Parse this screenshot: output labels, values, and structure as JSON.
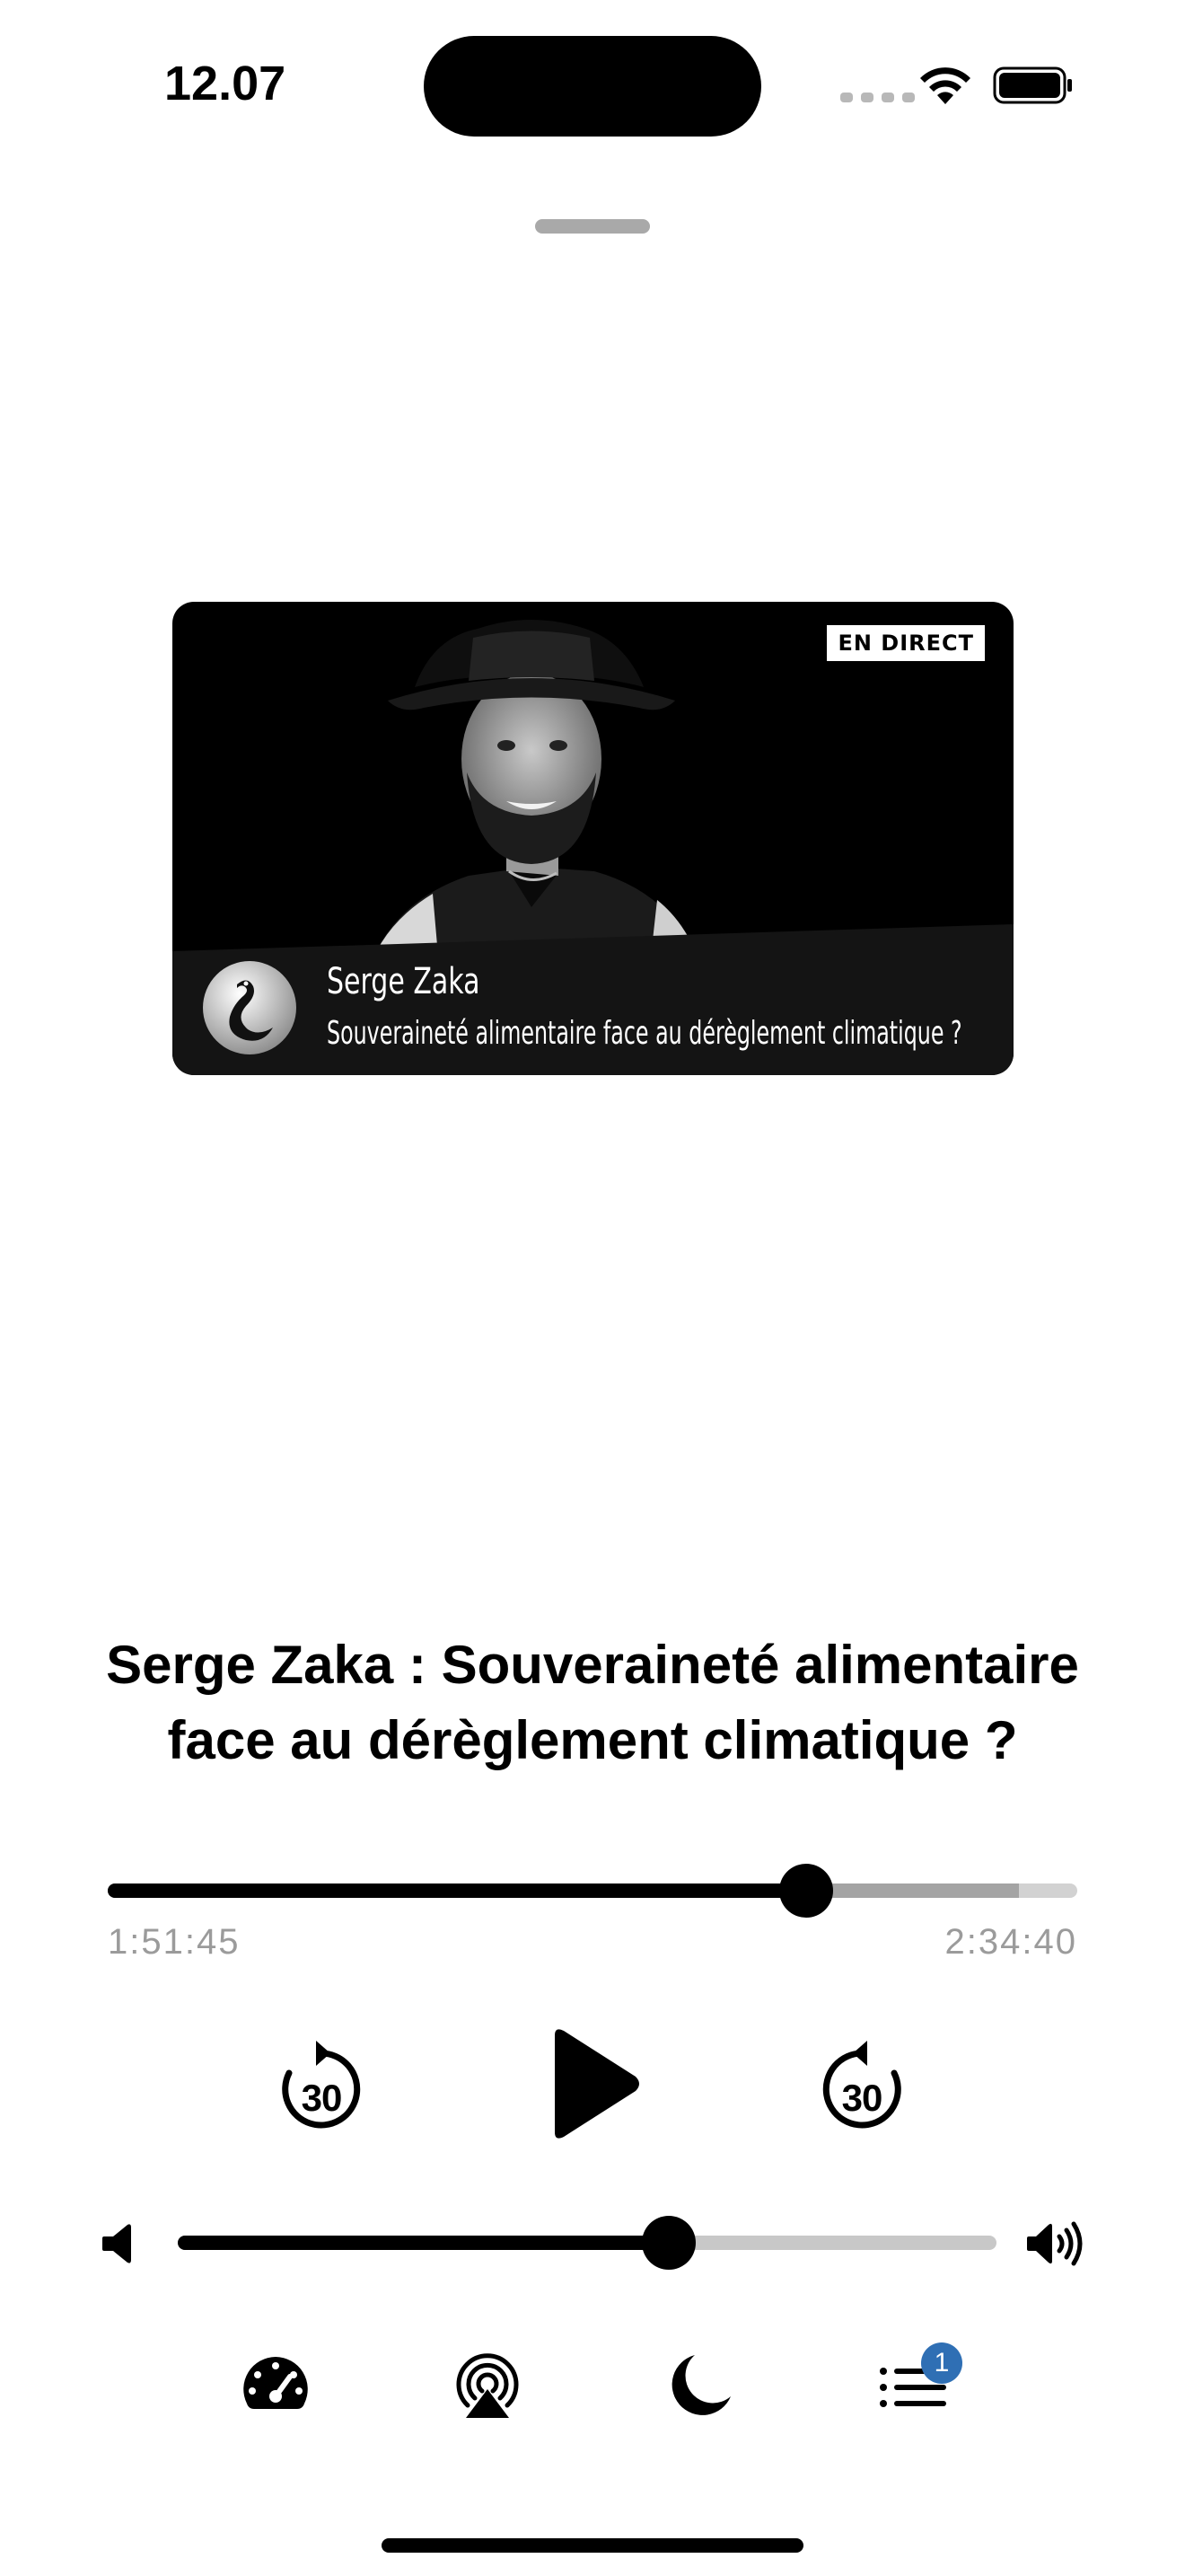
{
  "status_bar": {
    "time": "12.07"
  },
  "artwork": {
    "live_badge": "EN DIRECT",
    "speaker_name": "Serge Zaka",
    "episode_subtitle": "Souveraineté alimentaire face au dérèglement climatique ?"
  },
  "episode": {
    "title": "Serge Zaka : Souveraineté alimentaire face au dérèglement climatique ?"
  },
  "progress": {
    "elapsed": "1:51:45",
    "total": "2:34:40",
    "played_fraction": 0.72,
    "buffered_fraction": 0.94
  },
  "controls": {
    "skip_back_seconds": "30",
    "skip_forward_seconds": "30",
    "state": "paused"
  },
  "volume": {
    "level_fraction": 0.6
  },
  "toolbar": {
    "queue_count": "1"
  },
  "icons": [
    "wifi-icon",
    "battery-icon",
    "volume-min-icon",
    "volume-max-icon",
    "playback-speed-icon",
    "airplay-icon",
    "sleep-timer-icon",
    "queue-icon"
  ],
  "colors": {
    "accent": "#000000",
    "badge": "#2f6fb4",
    "track_inactive": "#d2d2d2",
    "time_text": "#9b9b9b"
  }
}
